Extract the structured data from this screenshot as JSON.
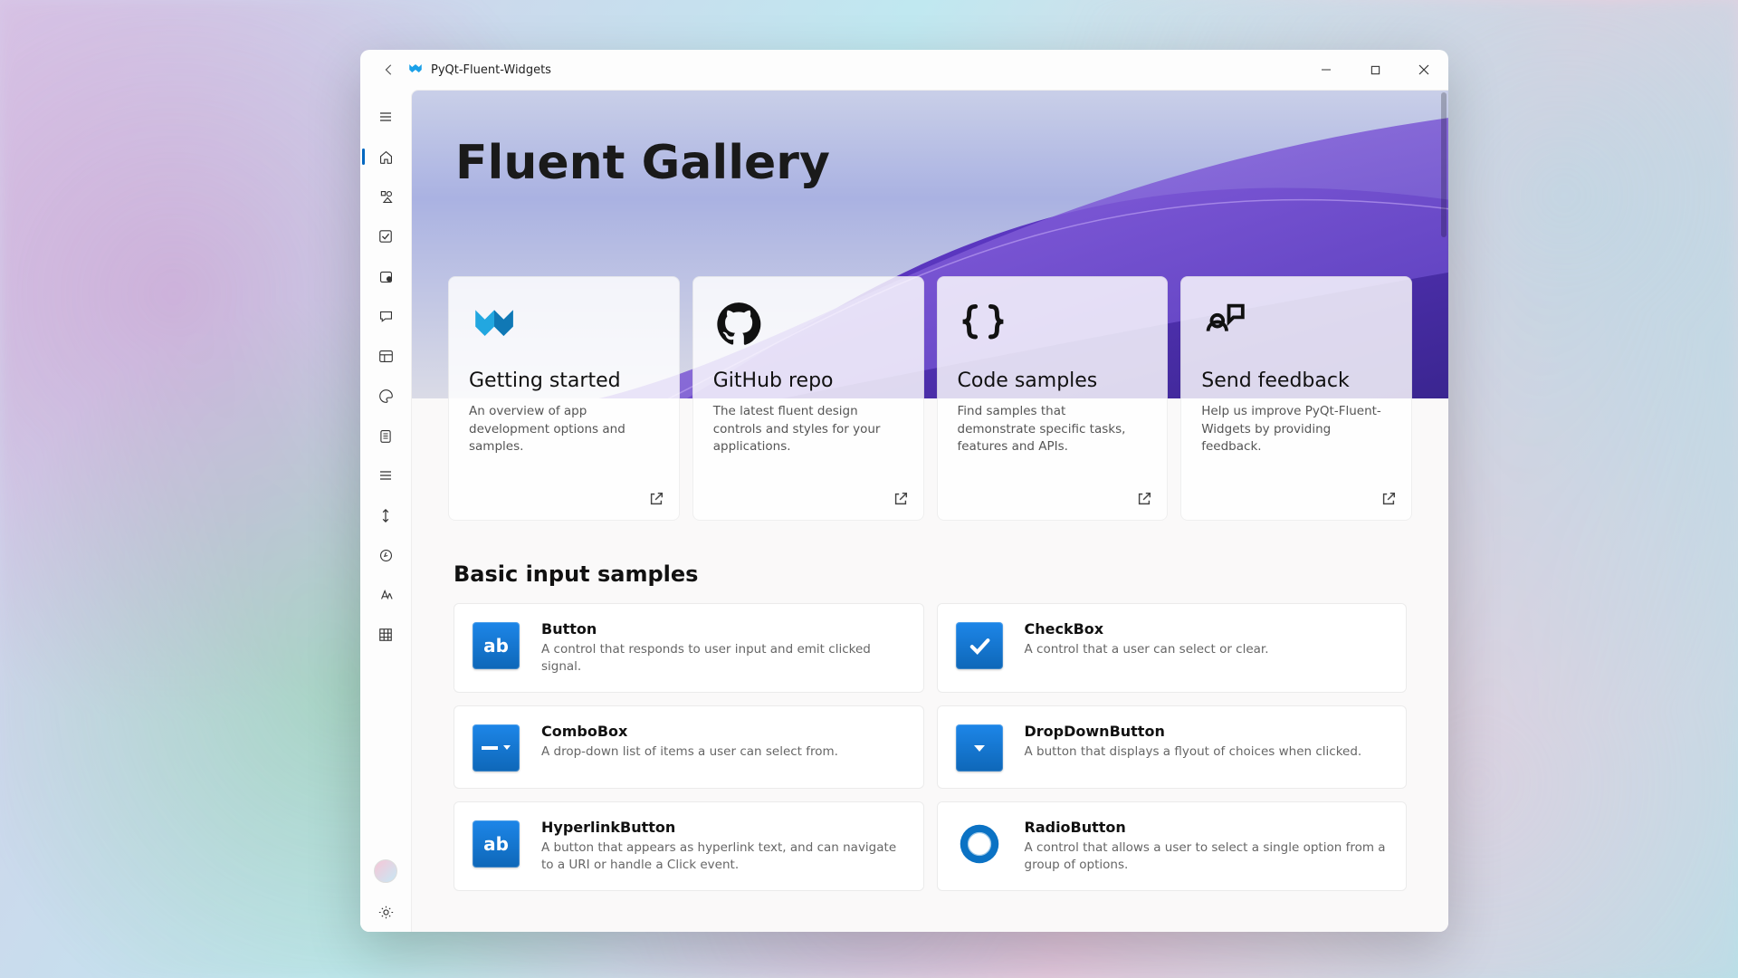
{
  "window": {
    "title": "PyQt-Fluent-Widgets"
  },
  "hero": {
    "title": "Fluent Gallery"
  },
  "linkCards": [
    {
      "title": "Getting started",
      "desc": "An overview of app development options and samples."
    },
    {
      "title": "GitHub repo",
      "desc": "The latest fluent design controls and styles for your applications."
    },
    {
      "title": "Code samples",
      "desc": "Find samples that demonstrate specific tasks, features and APIs."
    },
    {
      "title": "Send feedback",
      "desc": "Help us improve PyQt-Fluent-Widgets by providing feedback."
    }
  ],
  "sectionTitle": "Basic input samples",
  "samples": [
    {
      "title": "Button",
      "desc": "A control that responds to user input and emit clicked signal."
    },
    {
      "title": "CheckBox",
      "desc": "A control that a user can select or clear."
    },
    {
      "title": "ComboBox",
      "desc": "A drop-down list of items a user can select from."
    },
    {
      "title": "DropDownButton",
      "desc": "A button that displays a flyout of choices when clicked."
    },
    {
      "title": "HyperlinkButton",
      "desc": "A button that appears as hyperlink text, and can navigate to a URI or handle a Click event."
    },
    {
      "title": "RadioButton",
      "desc": "A control that allows a user to select a single option from a group of options."
    }
  ]
}
